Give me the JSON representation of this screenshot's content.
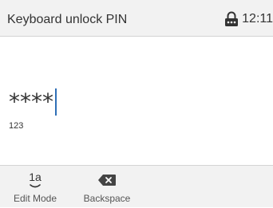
{
  "header": {
    "title": "Keyboard unlock PIN",
    "lock_icon": "lock-keypad-icon",
    "time": "12:11"
  },
  "pin": {
    "masked_value": "****",
    "input_mode": "123"
  },
  "softkeys": [
    {
      "label": "Edit Mode",
      "icon": "edit-mode-icon",
      "icon_text": "1a"
    },
    {
      "label": "Backspace",
      "icon": "backspace-icon"
    }
  ],
  "colors": {
    "header_bg": "#f2f2f2",
    "caret": "#2f6fb6",
    "text": "#333333"
  }
}
